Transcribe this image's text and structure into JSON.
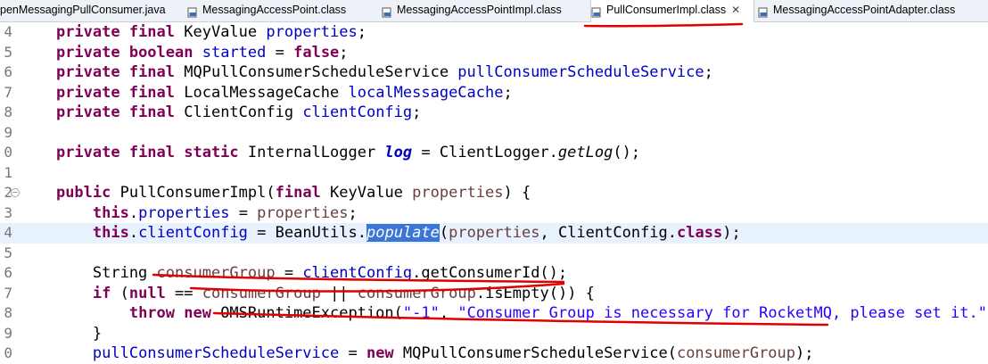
{
  "tabs": [
    {
      "label": "penMessagingPullConsumer.java",
      "icon": "java-file-icon",
      "active": false
    },
    {
      "label": "MessagingAccessPoint.class",
      "icon": "class-file-icon",
      "active": false
    },
    {
      "label": "MessagingAccessPointImpl.class",
      "icon": "class-file-icon",
      "active": false
    },
    {
      "label": "PullConsumerImpl.class",
      "icon": "class-file-icon",
      "active": true,
      "close": "✕"
    },
    {
      "label": "MessagingAccessPointAdapter.class",
      "icon": "class-file-icon",
      "active": false
    }
  ],
  "colors": {
    "keyword": "#7f0055",
    "field": "#0000c0",
    "string": "#2a00ff",
    "param": "#6a3e3e",
    "current_line": "#e8f2fe",
    "selection": "#3a75d8",
    "annotation_red": "#e00000"
  },
  "code_lines": [
    {
      "num": "4",
      "t": [
        [
          "    ",
          ""
        ],
        [
          "private final",
          "kw"
        ],
        [
          " KeyValue ",
          ""
        ],
        [
          "properties",
          "fld"
        ],
        [
          ";",
          ""
        ]
      ]
    },
    {
      "num": "5",
      "t": [
        [
          "    ",
          ""
        ],
        [
          "private boolean",
          "kw"
        ],
        [
          " ",
          ""
        ],
        [
          "started",
          "fld"
        ],
        [
          " = ",
          ""
        ],
        [
          "false",
          "kw"
        ],
        [
          ";",
          ""
        ]
      ]
    },
    {
      "num": "6",
      "t": [
        [
          "    ",
          ""
        ],
        [
          "private final",
          "kw"
        ],
        [
          " MQPullConsumerScheduleService ",
          ""
        ],
        [
          "pullConsumerScheduleService",
          "fld"
        ],
        [
          ";",
          ""
        ]
      ]
    },
    {
      "num": "7",
      "t": [
        [
          "    ",
          ""
        ],
        [
          "private final",
          "kw"
        ],
        [
          " LocalMessageCache ",
          ""
        ],
        [
          "localMessageCache",
          "fld"
        ],
        [
          ";",
          ""
        ]
      ]
    },
    {
      "num": "8",
      "t": [
        [
          "    ",
          ""
        ],
        [
          "private final",
          "kw"
        ],
        [
          " ClientConfig ",
          ""
        ],
        [
          "clientConfig",
          "fld"
        ],
        [
          ";",
          ""
        ]
      ]
    },
    {
      "num": "9",
      "t": []
    },
    {
      "num": "0",
      "t": [
        [
          "    ",
          ""
        ],
        [
          "private final static",
          "kw"
        ],
        [
          " InternalLogger ",
          ""
        ],
        [
          "log",
          "sf"
        ],
        [
          " = ClientLogger.",
          ""
        ],
        [
          "getLog",
          "mi"
        ],
        [
          "();",
          ""
        ]
      ]
    },
    {
      "num": "1",
      "t": []
    },
    {
      "num": "2",
      "fold": true,
      "t": [
        [
          "    ",
          ""
        ],
        [
          "public",
          "kw"
        ],
        [
          " PullConsumerImpl(",
          ""
        ],
        [
          "final",
          "kw"
        ],
        [
          " KeyValue ",
          ""
        ],
        [
          "properties",
          "prm"
        ],
        [
          ") {",
          ""
        ]
      ]
    },
    {
      "num": "3",
      "t": [
        [
          "        ",
          ""
        ],
        [
          "this",
          "kw"
        ],
        [
          ".",
          ""
        ],
        [
          "properties",
          "fld"
        ],
        [
          " = ",
          ""
        ],
        [
          "properties",
          "prm"
        ],
        [
          ";",
          ""
        ]
      ]
    },
    {
      "num": "4",
      "current": true,
      "t": [
        [
          "        ",
          ""
        ],
        [
          "this",
          "kw"
        ],
        [
          ".",
          ""
        ],
        [
          "clientConfig",
          "fld"
        ],
        [
          " = BeanUtils.",
          ""
        ],
        [
          "populate",
          "hl"
        ],
        [
          "(",
          ""
        ],
        [
          "properties",
          "prm"
        ],
        [
          ", ClientConfig.",
          ""
        ],
        [
          "class",
          "kw"
        ],
        [
          ");",
          ""
        ]
      ]
    },
    {
      "num": "5",
      "t": []
    },
    {
      "num": "6",
      "t": [
        [
          "        String ",
          ""
        ],
        [
          "consumerGroup",
          "prm"
        ],
        [
          " = ",
          ""
        ],
        [
          "clientConfig",
          "fld"
        ],
        [
          ".getConsumerId();",
          ""
        ]
      ]
    },
    {
      "num": "7",
      "t": [
        [
          "        ",
          ""
        ],
        [
          "if",
          "kw"
        ],
        [
          " (",
          ""
        ],
        [
          "null",
          "kw"
        ],
        [
          " == ",
          ""
        ],
        [
          "consumerGroup",
          "prm"
        ],
        [
          " || ",
          ""
        ],
        [
          "consumerGroup",
          "prm"
        ],
        [
          ".isEmpty()) {",
          ""
        ]
      ]
    },
    {
      "num": "8",
      "t": [
        [
          "            ",
          ""
        ],
        [
          "throw new",
          "kw"
        ],
        [
          " OMSRuntimeException(",
          ""
        ],
        [
          "\"-1\"",
          "str"
        ],
        [
          ", ",
          ""
        ],
        [
          "\"Consumer Group is necessary for RocketMQ, please set it.\"",
          "str"
        ],
        [
          ");",
          ""
        ]
      ]
    },
    {
      "num": "9",
      "t": [
        [
          "        }",
          ""
        ]
      ]
    },
    {
      "num": "0",
      "t": [
        [
          "        ",
          ""
        ],
        [
          "pullConsumerScheduleService",
          "fld"
        ],
        [
          " = ",
          ""
        ],
        [
          "new",
          "kw"
        ],
        [
          " MQPullConsumerScheduleService(",
          ""
        ],
        [
          "consumerGroup",
          "prm"
        ],
        [
          ");",
          ""
        ]
      ]
    }
  ]
}
